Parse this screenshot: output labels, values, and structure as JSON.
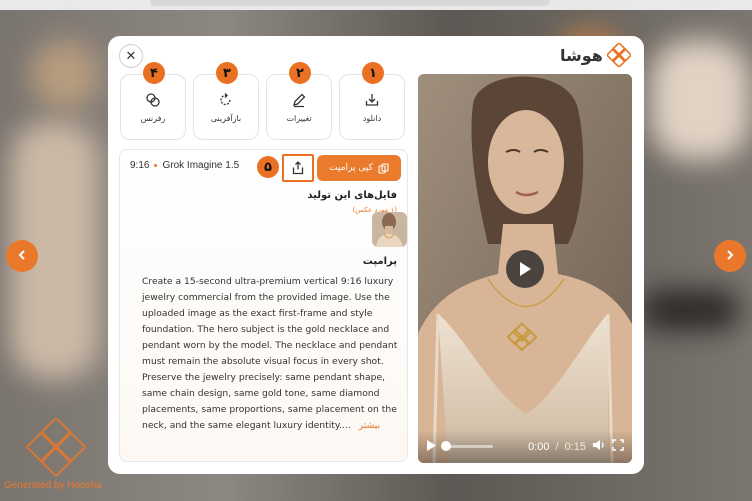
{
  "brand": {
    "name": "هوشا"
  },
  "watermark": {
    "text": "Generated by Hoosha"
  },
  "actions": [
    {
      "label": "دانلود",
      "badge": "۱",
      "icon": "download-icon"
    },
    {
      "label": "تغییرات",
      "badge": "۲",
      "icon": "edit-icon"
    },
    {
      "label": "بازآفرینی",
      "badge": "۳",
      "icon": "regenerate-icon"
    },
    {
      "label": "رفرنس",
      "badge": "۴",
      "icon": "reference-icon"
    }
  ],
  "meta": {
    "ratio": "9:16",
    "model": "Grok Imagine 1.5"
  },
  "share": {
    "badge": "۵",
    "icon": "share-icon"
  },
  "copy_button": {
    "label": "کپی پرامپت",
    "icon": "copy-icon"
  },
  "files": {
    "title": "فایل‌های این تولید",
    "count": "(۱ مورد عکس)"
  },
  "prompt": {
    "label": "پرامپت",
    "text": "Create a 15-second ultra-premium vertical 9:16 luxury jewelry commercial from the provided image. Use the uploaded image as the exact first-frame and style foundation. The hero subject is the gold necklace and pendant worn by the model. The necklace and pendant must remain the absolute visual focus in every shot. Preserve the jewelry precisely: same pendant shape, same chain design, same gold tone, same diamond placements, same proportions, same placement on the neck, and the same elegant luxury identity....",
    "more": "بیشتر"
  },
  "video": {
    "current_time": "0:00",
    "separator": "/",
    "duration": "0:15",
    "progress": 0
  },
  "colors": {
    "accent": "#ea7024",
    "accent_button": "#ea7b2c"
  }
}
